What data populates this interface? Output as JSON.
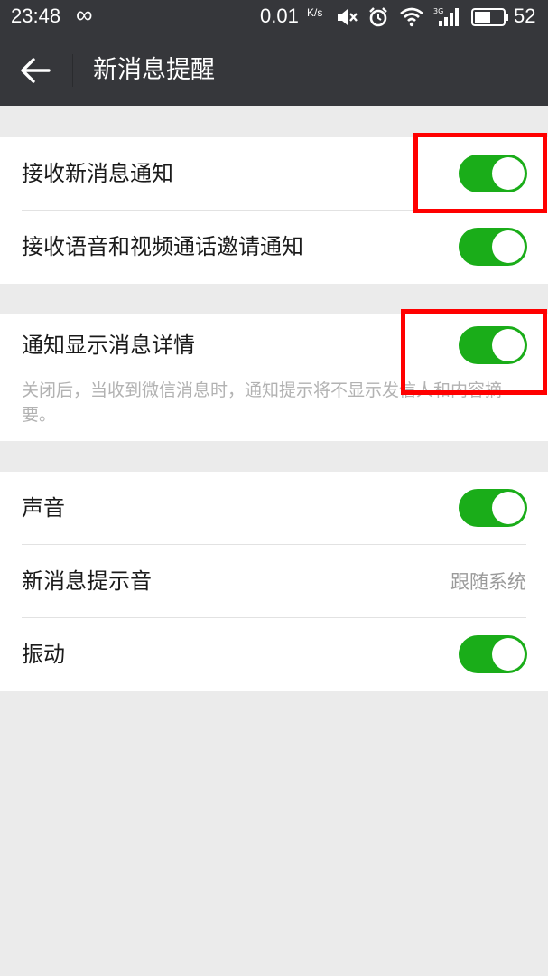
{
  "status_bar": {
    "time": "23:48",
    "net_speed": "0.01",
    "net_unit": "K/s",
    "battery": "52",
    "icons": [
      "infinity-icon",
      "mute-icon",
      "alarm-icon",
      "wifi-icon",
      "signal-icon",
      "battery-icon"
    ]
  },
  "header": {
    "title": "新消息提醒",
    "back_icon": "arrow-left-icon"
  },
  "settings": {
    "receive_new_messages": {
      "label": "接收新消息通知",
      "enabled": true
    },
    "receive_call_invites": {
      "label": "接收语音和视频通话邀请通知",
      "enabled": true
    },
    "show_message_details": {
      "label": "通知显示消息详情",
      "enabled": true,
      "description": "关闭后，当收到微信消息时，通知提示将不显示发信人和内容摘要。"
    },
    "sound": {
      "label": "声音",
      "enabled": true
    },
    "message_tone": {
      "label": "新消息提示音",
      "value": "跟随系统"
    },
    "vibrate": {
      "label": "振动",
      "enabled": true
    }
  },
  "colors": {
    "toggle_on": "#1aad19",
    "bar": "#36373b",
    "page_bg": "#ebebeb",
    "highlight": "#ff0000"
  }
}
